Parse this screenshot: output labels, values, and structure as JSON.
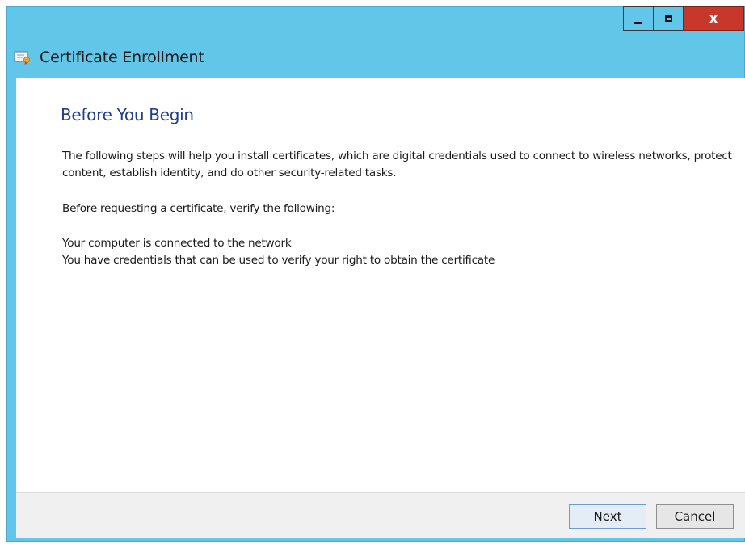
{
  "window": {
    "title": "Certificate Enrollment",
    "caption_buttons": {
      "minimize_icon": "minimize-icon",
      "maximize_icon": "maximize-icon",
      "close_glyph": "x"
    },
    "accent_color": "#62c6e8",
    "close_color": "#c7372a"
  },
  "page": {
    "heading": "Before You Begin",
    "intro": "The following steps will help you install certificates, which are digital credentials used to connect to wireless networks, protect content, establish identity, and do other security-related tasks.",
    "verify_prompt": "Before requesting a certificate, verify the following:",
    "requirements": [
      "Your computer is connected to the network",
      "You have credentials that can be used to verify your right to obtain the certificate"
    ]
  },
  "footer": {
    "next_label": "Next",
    "cancel_label": "Cancel"
  }
}
